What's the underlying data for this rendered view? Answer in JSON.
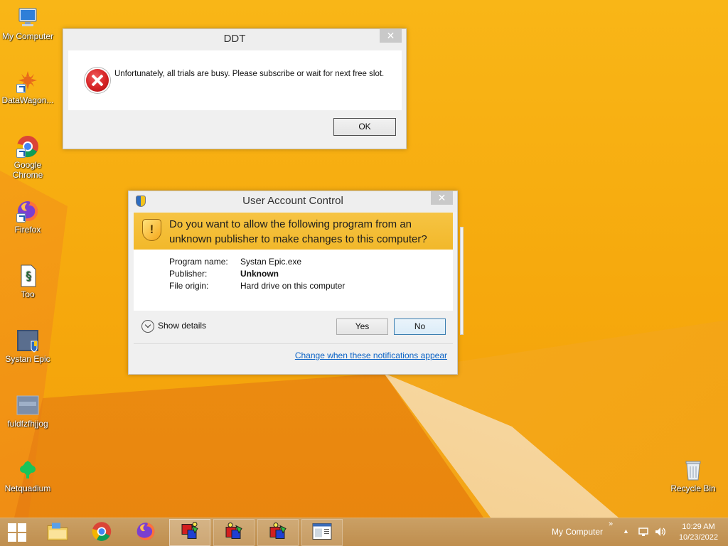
{
  "desktop_icons": [
    {
      "label": "My Computer",
      "icon": "computer-icon"
    },
    {
      "label": "DataWagon...",
      "icon": "datawagon-icon"
    },
    {
      "label": "Google Chrome",
      "icon": "chrome-icon"
    },
    {
      "label": "Firefox",
      "icon": "firefox-icon"
    },
    {
      "label": "Too",
      "icon": "document-icon"
    },
    {
      "label": "Systan Epic",
      "icon": "systan-epic-icon"
    },
    {
      "label": "fuldfzfhjjog",
      "icon": "file-icon"
    },
    {
      "label": "Netquadium",
      "icon": "netquadium-icon"
    },
    {
      "label": "Recycle Bin",
      "icon": "recycle-bin-icon"
    }
  ],
  "ddt_dialog": {
    "title": "DDT",
    "close": "✕",
    "message": "Unfortunately, all trials are busy. Please subscribe or wait for next free slot.",
    "ok_label": "OK"
  },
  "uac_dialog": {
    "title": "User Account Control",
    "close": "✕",
    "question": "Do you want to allow the following program from an unknown publisher to make changes to this computer?",
    "program_name_label": "Program name:",
    "program_name": "Systan Epic.exe",
    "publisher_label": "Publisher:",
    "publisher": "Unknown",
    "file_origin_label": "File origin:",
    "file_origin": "Hard drive on this computer",
    "show_details": "Show details",
    "yes_label": "Yes",
    "no_label": "No",
    "change_link": "Change when these notifications appear"
  },
  "taskbar": {
    "toolbar_label": "My Computer",
    "overflow": "»",
    "time": "10:29 AM",
    "date": "10/23/2022"
  },
  "colors": {
    "wallpaper": "#f7ae0d",
    "uac_banner": "#f6c444",
    "link": "#0b63c6"
  }
}
